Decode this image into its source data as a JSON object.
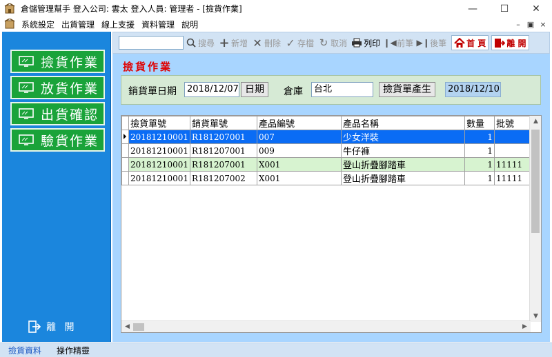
{
  "window": {
    "title": "倉儲管理幫手  登入公司: 雲太  登入人員: 管理者 - [撿貨作業]"
  },
  "menu": [
    "系統設定",
    "出貨管理",
    "線上支援",
    "資料管理",
    "說明"
  ],
  "sidebar": {
    "buttons": [
      "撿貨作業",
      "放貨作業",
      "出貨確認",
      "驗貨作業"
    ],
    "exit_label": "離 開"
  },
  "toolbar": {
    "search_value": "",
    "search_label": "搜尋",
    "add_label": "新增",
    "delete_label": "刪除",
    "save_label": "存檔",
    "cancel_label": "取消",
    "print_label": "列印",
    "prev_label": "前筆",
    "next_label": "後筆",
    "home_label": "首 頁",
    "exit_label": "離 開"
  },
  "form": {
    "title": "撿貨作業",
    "sales_date_label": "銷貨單日期",
    "sales_date_value": "2018/12/07",
    "date_button": "日期",
    "warehouse_label": "倉庫",
    "warehouse_value": "台北",
    "generate_button": "撿貨單產生",
    "generated_date": "2018/12/10"
  },
  "grid": {
    "columns": [
      "撿貨單號",
      "銷貨單號",
      "產品編號",
      "產品名稱",
      "數量",
      "批號"
    ],
    "rows": [
      {
        "pick_no": "20181210001",
        "sales_no": "R181207001",
        "product_code": "007",
        "product_name": "少女洋裝",
        "qty": "1",
        "batch": ""
      },
      {
        "pick_no": "20181210001",
        "sales_no": "R181207001",
        "product_code": "009",
        "product_name": "牛仔褲",
        "qty": "1",
        "batch": ""
      },
      {
        "pick_no": "20181210001",
        "sales_no": "R181207001",
        "product_code": "X001",
        "product_name": "登山折疊腳踏車",
        "qty": "1",
        "batch": "11111"
      },
      {
        "pick_no": "20181210001",
        "sales_no": "R181207002",
        "product_code": "X001",
        "product_name": "登山折疊腳踏車",
        "qty": "1",
        "batch": "11111"
      }
    ]
  },
  "statusbar": {
    "item1": "撿貨資料",
    "item2": "操作精靈"
  },
  "colors": {
    "sidebar_bg": "#1b86dd",
    "sidebar_button": "#1aa33a",
    "content_bg": "#a8d5ff",
    "form_panel": "#d6ead5",
    "title_red": "#e00000",
    "row_selected": "#0a6cf5",
    "row_alt": "#d7f3d0"
  }
}
